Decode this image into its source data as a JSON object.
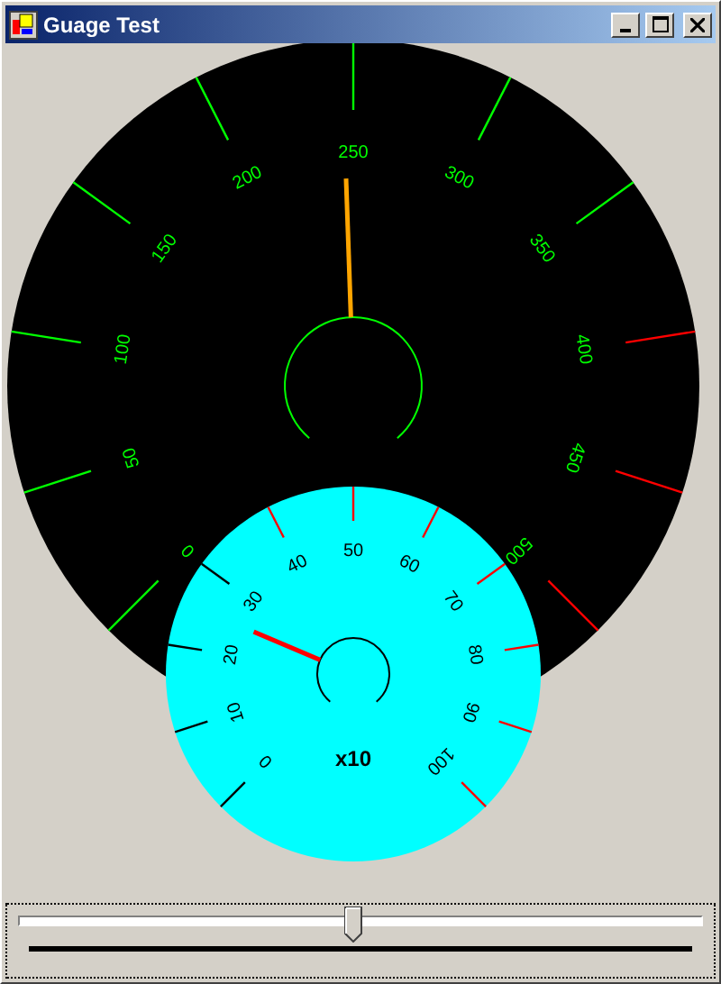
{
  "window": {
    "title": "Guage Test"
  },
  "gauges": [
    {
      "kind": "large",
      "labels": [
        "0",
        "50",
        "100",
        "150",
        "200",
        "250",
        "300",
        "350",
        "400",
        "450",
        "500"
      ],
      "ticks": [
        {
          "color": "#00ff00"
        },
        {
          "color": "#00ff00"
        },
        {
          "color": "#00ff00"
        },
        {
          "color": "#00ff00"
        },
        {
          "color": "#00ff00"
        },
        {
          "color": "#00ff00"
        },
        {
          "color": "#00ff00"
        },
        {
          "color": "#00ff00"
        },
        {
          "color": "#ff0000"
        },
        {
          "color": "#ff0000"
        },
        {
          "color": "#ff0000"
        }
      ]
    },
    {
      "kind": "small",
      "caption": "x10",
      "labels": [
        "0",
        "10",
        "20",
        "30",
        "40",
        "50",
        "60",
        "70",
        "80",
        "90",
        "100"
      ],
      "ticks": [
        {
          "color": "#000000"
        },
        {
          "color": "#000000"
        },
        {
          "color": "#000000"
        },
        {
          "color": "#000000"
        },
        {
          "color": "#ff0000"
        },
        {
          "color": "#ff0000"
        },
        {
          "color": "#ff0000"
        },
        {
          "color": "#ff0000"
        },
        {
          "color": "#ff0000"
        },
        {
          "color": "#ff0000"
        },
        {
          "color": "#ff0000"
        }
      ]
    }
  ],
  "slider": {
    "level": 0.49
  }
}
